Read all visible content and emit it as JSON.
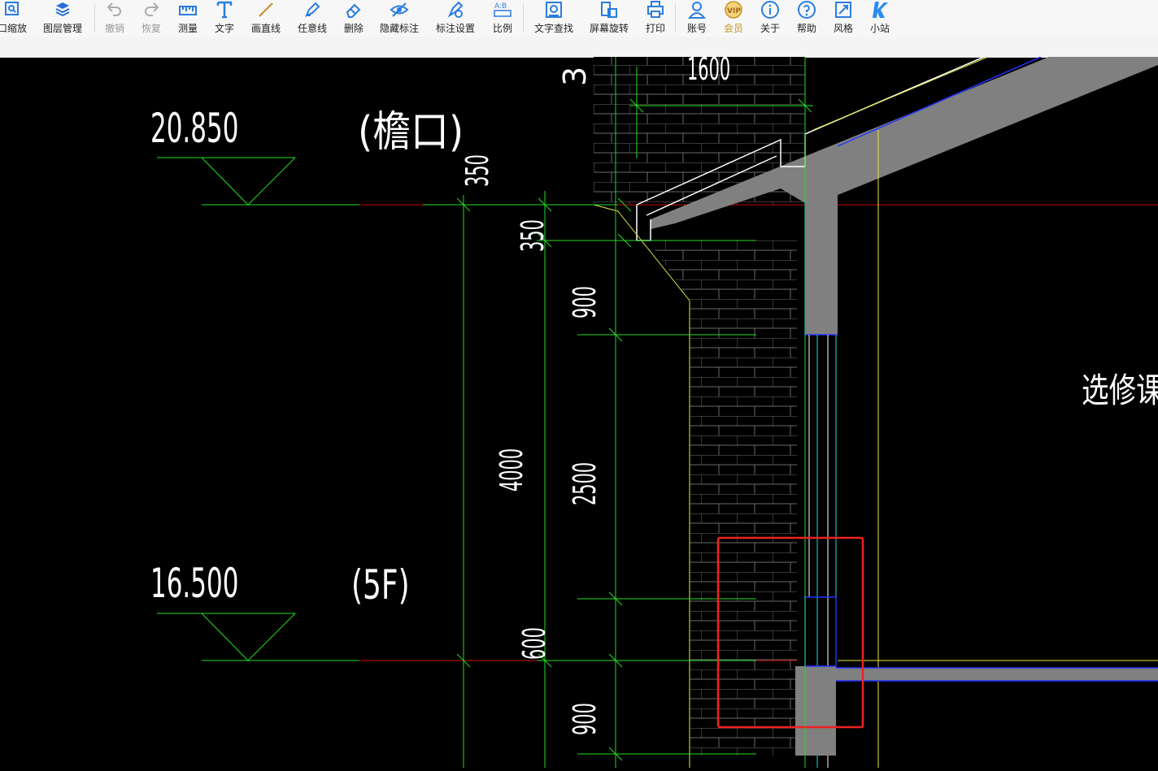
{
  "toolbar": {
    "items": [
      {
        "label": "口缩放",
        "icon": "zoom-window-icon"
      },
      {
        "label": "图层管理",
        "icon": "layers-icon"
      },
      {
        "label": "撤销",
        "icon": "undo-icon",
        "disabled": true
      },
      {
        "label": "恢复",
        "icon": "redo-icon",
        "disabled": true
      },
      {
        "label": "测量",
        "icon": "measure-icon"
      },
      {
        "label": "文字",
        "icon": "text-icon"
      },
      {
        "label": "画直线",
        "icon": "line-icon"
      },
      {
        "label": "任意线",
        "icon": "pen-icon"
      },
      {
        "label": "删除",
        "icon": "eraser-icon"
      },
      {
        "label": "隐藏标注",
        "icon": "eye-icon"
      },
      {
        "label": "标注设置",
        "icon": "annotation-settings-icon"
      },
      {
        "label": "比例",
        "icon": "scale-icon"
      },
      {
        "label": "文字查找",
        "icon": "text-search-icon"
      },
      {
        "label": "屏幕旋转",
        "icon": "rotate-screen-icon"
      },
      {
        "label": "打印",
        "icon": "print-icon"
      },
      {
        "label": "账号",
        "icon": "account-icon"
      },
      {
        "label": "会员",
        "icon": "vip-icon"
      },
      {
        "label": "关于",
        "icon": "info-icon"
      },
      {
        "label": "帮助",
        "icon": "help-icon"
      },
      {
        "label": "风格",
        "icon": "style-icon"
      },
      {
        "label": "小站",
        "icon": "site-icon"
      }
    ]
  },
  "drawing": {
    "elevation_top": "20.850",
    "elevation_top_note": "(檐口)",
    "elevation_bottom": "16.500",
    "elevation_bottom_note": "(5F)",
    "room_label": "选修课室",
    "dims": {
      "d1600": "1600",
      "d3": "3",
      "d350a": "350",
      "d350b": "350",
      "d900a": "900",
      "d4000": "4000",
      "d2500": "2500",
      "d600": "600",
      "d900b": "900"
    },
    "colors": {
      "dim_line": "#22dd22",
      "axis": "#cc0000",
      "wall_fill": "#808080",
      "outline_blue": "#2233ff",
      "highlight": "#ee2222",
      "yellow": "#e8e840",
      "cyan": "#22dddd"
    }
  }
}
